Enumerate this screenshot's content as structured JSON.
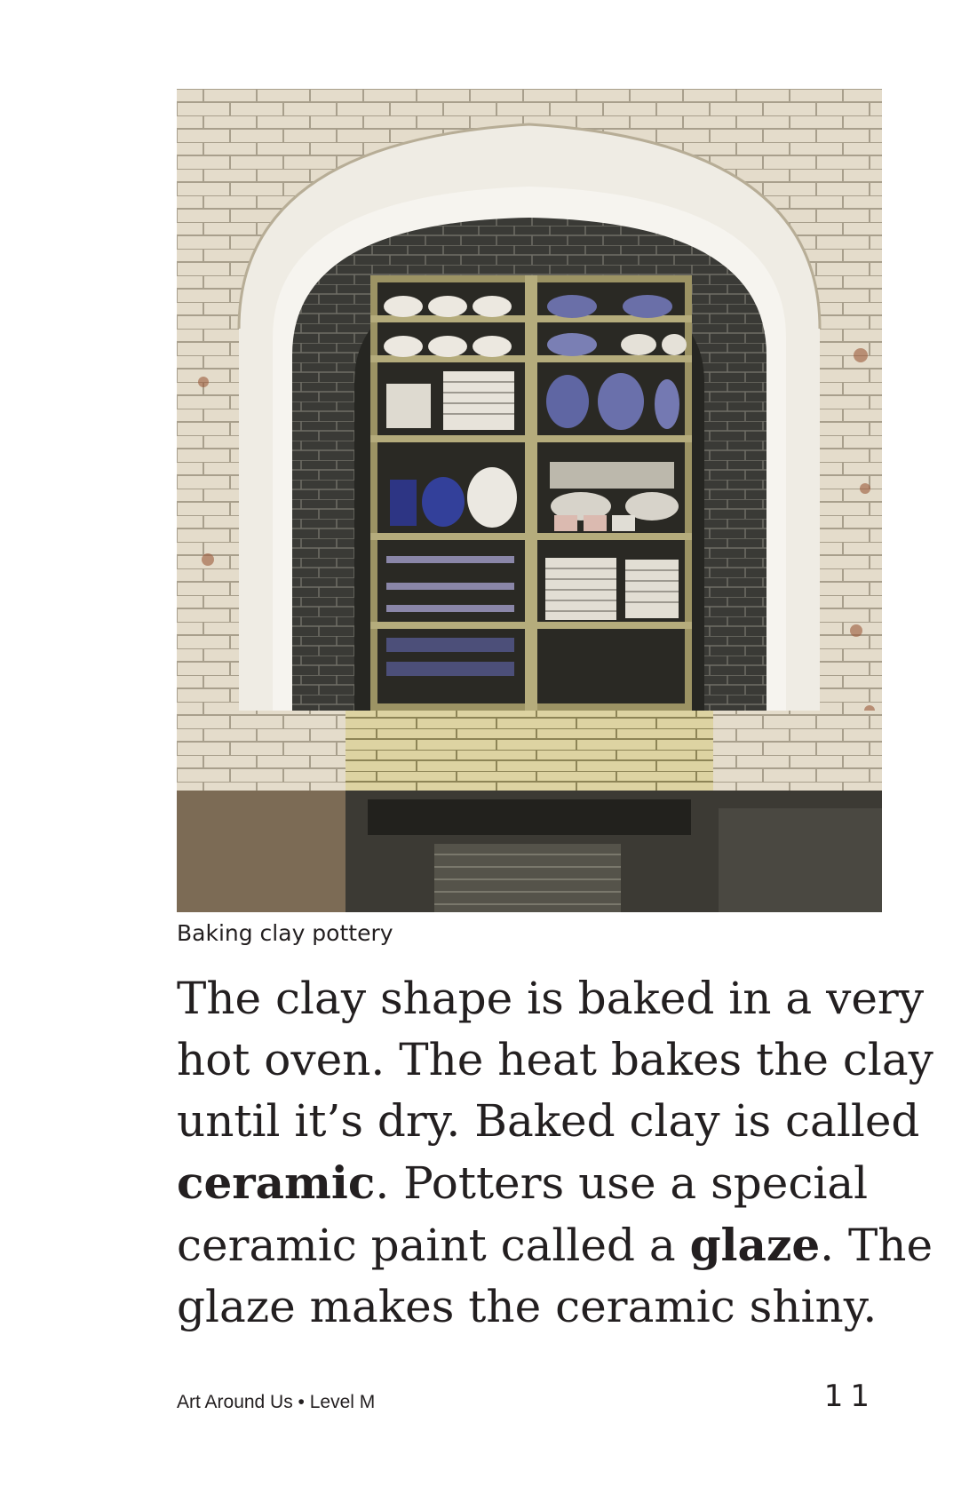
{
  "photo": {
    "alt": "Kiln filled with shelves of blue and white pottery"
  },
  "caption": "Baking clay pottery",
  "paragraph": {
    "line1": "The clay shape is baked in a very",
    "line2": "hot oven. The heat bakes the clay",
    "line3": "until it’s dry. Baked clay is called",
    "line4_bold": "ceramic",
    "line4_rest": ". Potters use a special",
    "line5_start": "ceramic paint called a ",
    "line5_bold": "glaze",
    "line5_rest": ". The",
    "line6": "glaze makes the ceramic shiny."
  },
  "footer": {
    "title": "Art Around Us • Level M",
    "page_number": "11"
  }
}
